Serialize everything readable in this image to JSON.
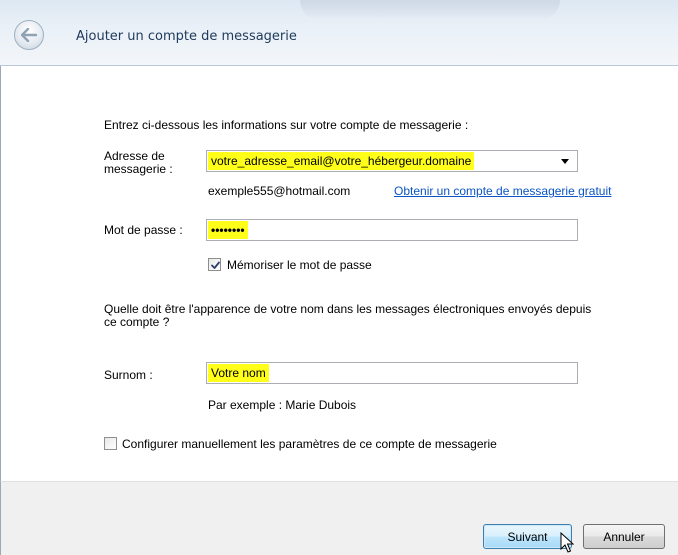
{
  "header": {
    "title": "Ajouter un compte de messagerie"
  },
  "form": {
    "intro": "Entrez ci-dessous les informations sur votre compte de messagerie :",
    "email_label_line1": "Adresse de",
    "email_label_line2": "messagerie :",
    "email_value": "votre_adresse_email@votre_hébergeur.domaine",
    "email_example": "exemple555@hotmail.com",
    "free_account_link": "Obtenir un compte de messagerie gratuit",
    "password_label": "Mot de passe :",
    "password_value": "••••••••",
    "remember_password_label": "Mémoriser le mot de passe",
    "remember_password_checked": true,
    "name_question_line1": "Quelle doit être l'apparence de votre nom dans les messages électroniques envoyés depuis",
    "name_question_line2": "ce compte ?",
    "nickname_label": "Surnom :",
    "nickname_value": "Votre nom",
    "nickname_example": "Par exemple : Marie Dubois",
    "manual_config_label": "Configurer manuellement les paramètres de ce compte de messagerie",
    "manual_config_checked": false
  },
  "footer": {
    "next_label": "Suivant",
    "cancel_label": "Annuler"
  },
  "colors": {
    "highlight": "#ffff1a",
    "link": "#0b55c4"
  },
  "icons": {
    "back": "back-arrow-icon",
    "dropdown": "chevron-down-icon",
    "check": "checkmark-icon",
    "cursor": "mouse-pointer-icon"
  }
}
